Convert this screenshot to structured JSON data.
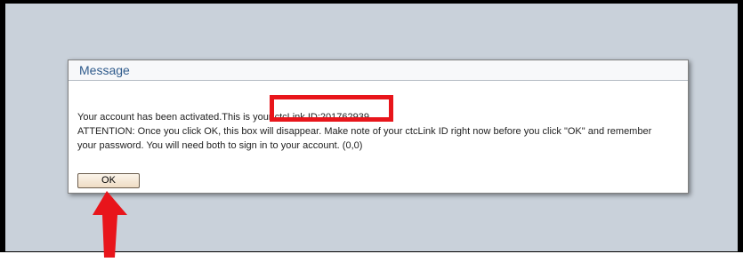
{
  "dialog": {
    "title": "Message",
    "line1_prefix": "Your account has been activated.This is your ",
    "ctclink_id": "ctcLink ID:201762939",
    "line2": "ATTENTION: Once you click OK, this box will disappear. Make note of your ctcLink ID right now before you click \"OK\" and remember",
    "line3": "your password. You will need both to sign in to your account. (0,0)",
    "ok_label": "OK"
  },
  "annotations": {
    "highlight_color": "#e8151b",
    "arrow_color": "#e8151b"
  },
  "colors": {
    "background": "#c9d1da",
    "title_text": "#2f5b8c"
  }
}
